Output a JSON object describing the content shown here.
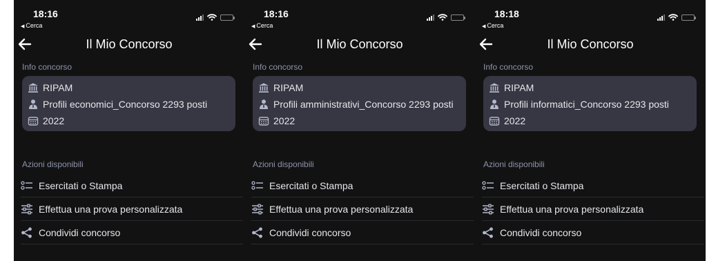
{
  "screens": [
    {
      "time": "18:16",
      "back_app": "Cerca",
      "title": "Il Mio Concorso",
      "info_section": "Info concorso",
      "info": {
        "ente": "RIPAM",
        "profilo": "Profili economici_Concorso 2293 posti",
        "anno": "2022"
      },
      "actions_section": "Azioni disponibili",
      "actions": [
        "Esercitati o Stampa",
        "Effettua una prova personalizzata",
        "Condividi concorso"
      ]
    },
    {
      "time": "18:16",
      "back_app": "Cerca",
      "title": "Il Mio Concorso",
      "info_section": "Info concorso",
      "info": {
        "ente": "RIPAM",
        "profilo": "Profili amministrativi_Concorso 2293 posti",
        "anno": "2022"
      },
      "actions_section": "Azioni disponibili",
      "actions": [
        "Esercitati o Stampa",
        "Effettua una prova personalizzata",
        "Condividi concorso"
      ]
    },
    {
      "time": "18:18",
      "back_app": "Cerca",
      "title": "Il Mio Concorso",
      "info_section": "Info concorso",
      "info": {
        "ente": "RIPAM",
        "profilo": "Profili informatici_Concorso 2293 posti",
        "anno": "2022"
      },
      "actions_section": "Azioni disponibili",
      "actions": [
        "Esercitati o Stampa",
        "Effettua una prova personalizzata",
        "Condividi concorso"
      ]
    }
  ],
  "icons": {
    "back": "arrow-left-icon",
    "ente": "bank-icon",
    "profilo": "person-icon",
    "anno": "calendar-icon",
    "action_0": "checklist-icon",
    "action_1": "sliders-icon",
    "action_2": "share-icon"
  },
  "colors": {
    "background": "#121213",
    "card": "#363742",
    "section_label": "#8e93a8",
    "icon_tint": "#b3b8cc",
    "text": "#e6e7ec"
  }
}
